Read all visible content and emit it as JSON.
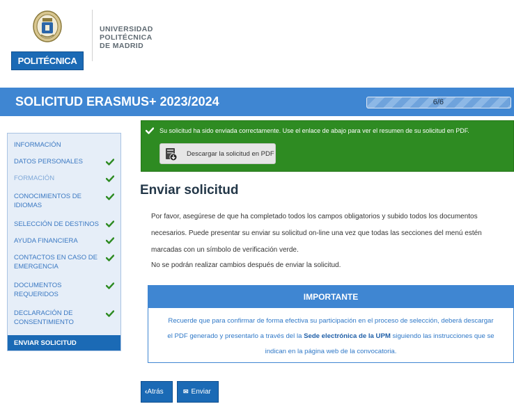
{
  "header": {
    "logo_text": "POLITÉCNICA",
    "university_lines": [
      "UNIVERSIDAD",
      "POLITÉCNICA",
      "DE MADRID"
    ]
  },
  "title_bar": {
    "title": "SOLICITUD ERASMUS+ 2023/2024",
    "progress_text": "6/6",
    "progress_fraction": 1.0,
    "color": "#3f86d2"
  },
  "sidebar": {
    "items": [
      {
        "label": "INFORMACIÓN",
        "checked": false,
        "state": "normal"
      },
      {
        "label": "DATOS PERSONALES",
        "checked": true,
        "state": "normal"
      },
      {
        "label": "FORMACIÓN",
        "checked": true,
        "state": "muted"
      },
      {
        "label": "CONOCIMIENTOS DE IDIOMAS",
        "checked": true,
        "state": "normal"
      },
      {
        "label": "SELECCIÓN DE DESTINOS",
        "checked": true,
        "state": "normal"
      },
      {
        "label": "AYUDA FINANCIERA",
        "checked": true,
        "state": "normal"
      },
      {
        "label": "CONTACTOS EN CASO DE EMERGENCIA",
        "checked": true,
        "state": "normal"
      },
      {
        "label": "DOCUMENTOS REQUERIDOS",
        "checked": true,
        "state": "normal"
      },
      {
        "label": "DECLARACIÓN DE CONSENTIMIENTO",
        "checked": true,
        "state": "normal"
      },
      {
        "label": "ENVIAR SOLICITUD",
        "checked": false,
        "state": "active"
      }
    ],
    "check_color": "#2e8b22"
  },
  "alert": {
    "message": "Su solicitud ha sido enviada correctamente. Use el enlace de abajo para ver el resumen de su solicitud en PDF.",
    "pdf_button_label": "Descargar la solicitud en PDF",
    "pdf_icon": "pdf-download-icon",
    "color": "#2e8b22"
  },
  "main": {
    "heading": "Enviar solicitud",
    "paragraph_lines": [
      "Por favor, asegúrese de que ha completado todos los campos obligatorios y subido todos los documentos",
      "necesarios. Puede presentar su enviar su solicitud on-line una vez que todas las secciones del menú estén",
      "marcadas con un símbolo de verificación verde.",
      "No se podrán realizar cambios después de enviar la solicitud."
    ]
  },
  "important": {
    "title": "IMPORTANTE",
    "line1": "Recuerde que para confirmar de forma efectiva su participación en el proceso de selección, deberá descargar",
    "line2_pre": "el PDF generado y presentarlo a través del la ",
    "line2_bold": "Sede electrónica de la UPM",
    "line2_post": " siguiendo las instrucciones que se",
    "line3": "indican en la página web de la convocatoria."
  },
  "footer": {
    "back_label": "Atrás",
    "back_icon": "chevron-left-icon",
    "send_label": "Enviar",
    "send_icon": "send-icon"
  }
}
